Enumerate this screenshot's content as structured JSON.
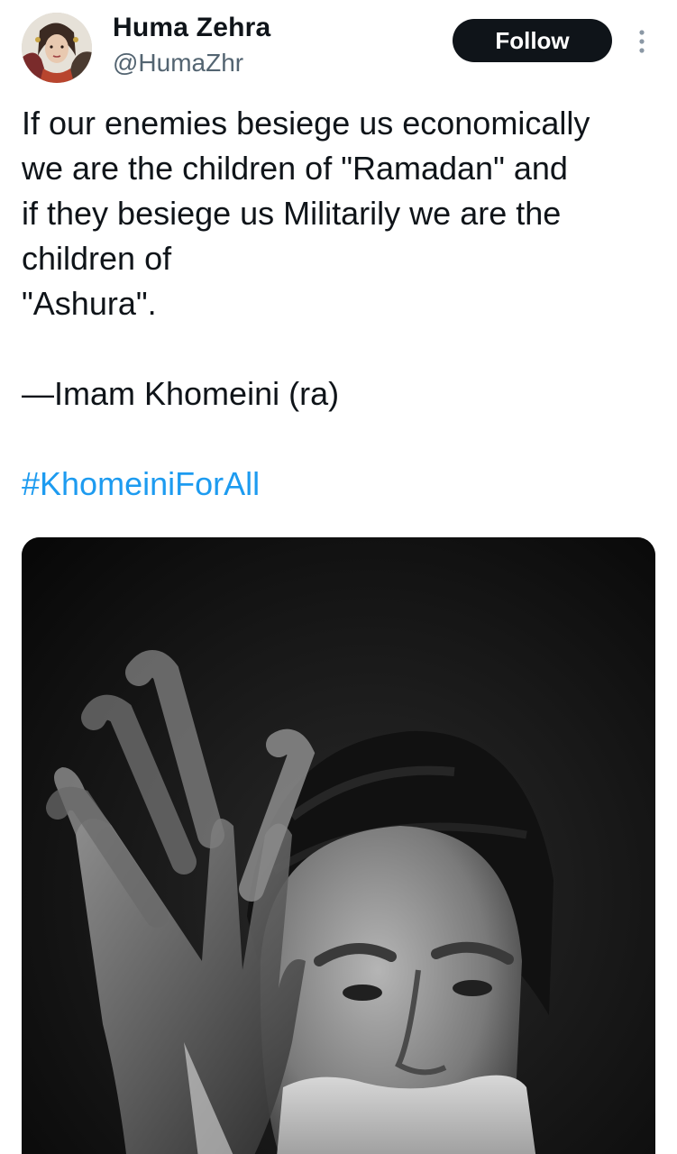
{
  "author": {
    "display_name": "Huma Zehra",
    "handle": "@HumaZhr",
    "avatar_icon": "user-avatar"
  },
  "actions": {
    "follow_label": "Follow",
    "more_icon": "more-vertical-icon"
  },
  "tweet": {
    "lines": [
      "If our enemies besiege us economically",
      "we are the children of \"Ramadan\" and",
      "if they besiege us Militarily we are the",
      "children of",
      "\"Ashura\"."
    ],
    "attribution": "—Imam Khomeini (ra)",
    "hashtag": "#KhomeiniForAll"
  },
  "colors": {
    "accent": "#1d9bf0",
    "text": "#0f1419",
    "secondary_text": "#536471",
    "button_bg": "#0f1419"
  }
}
